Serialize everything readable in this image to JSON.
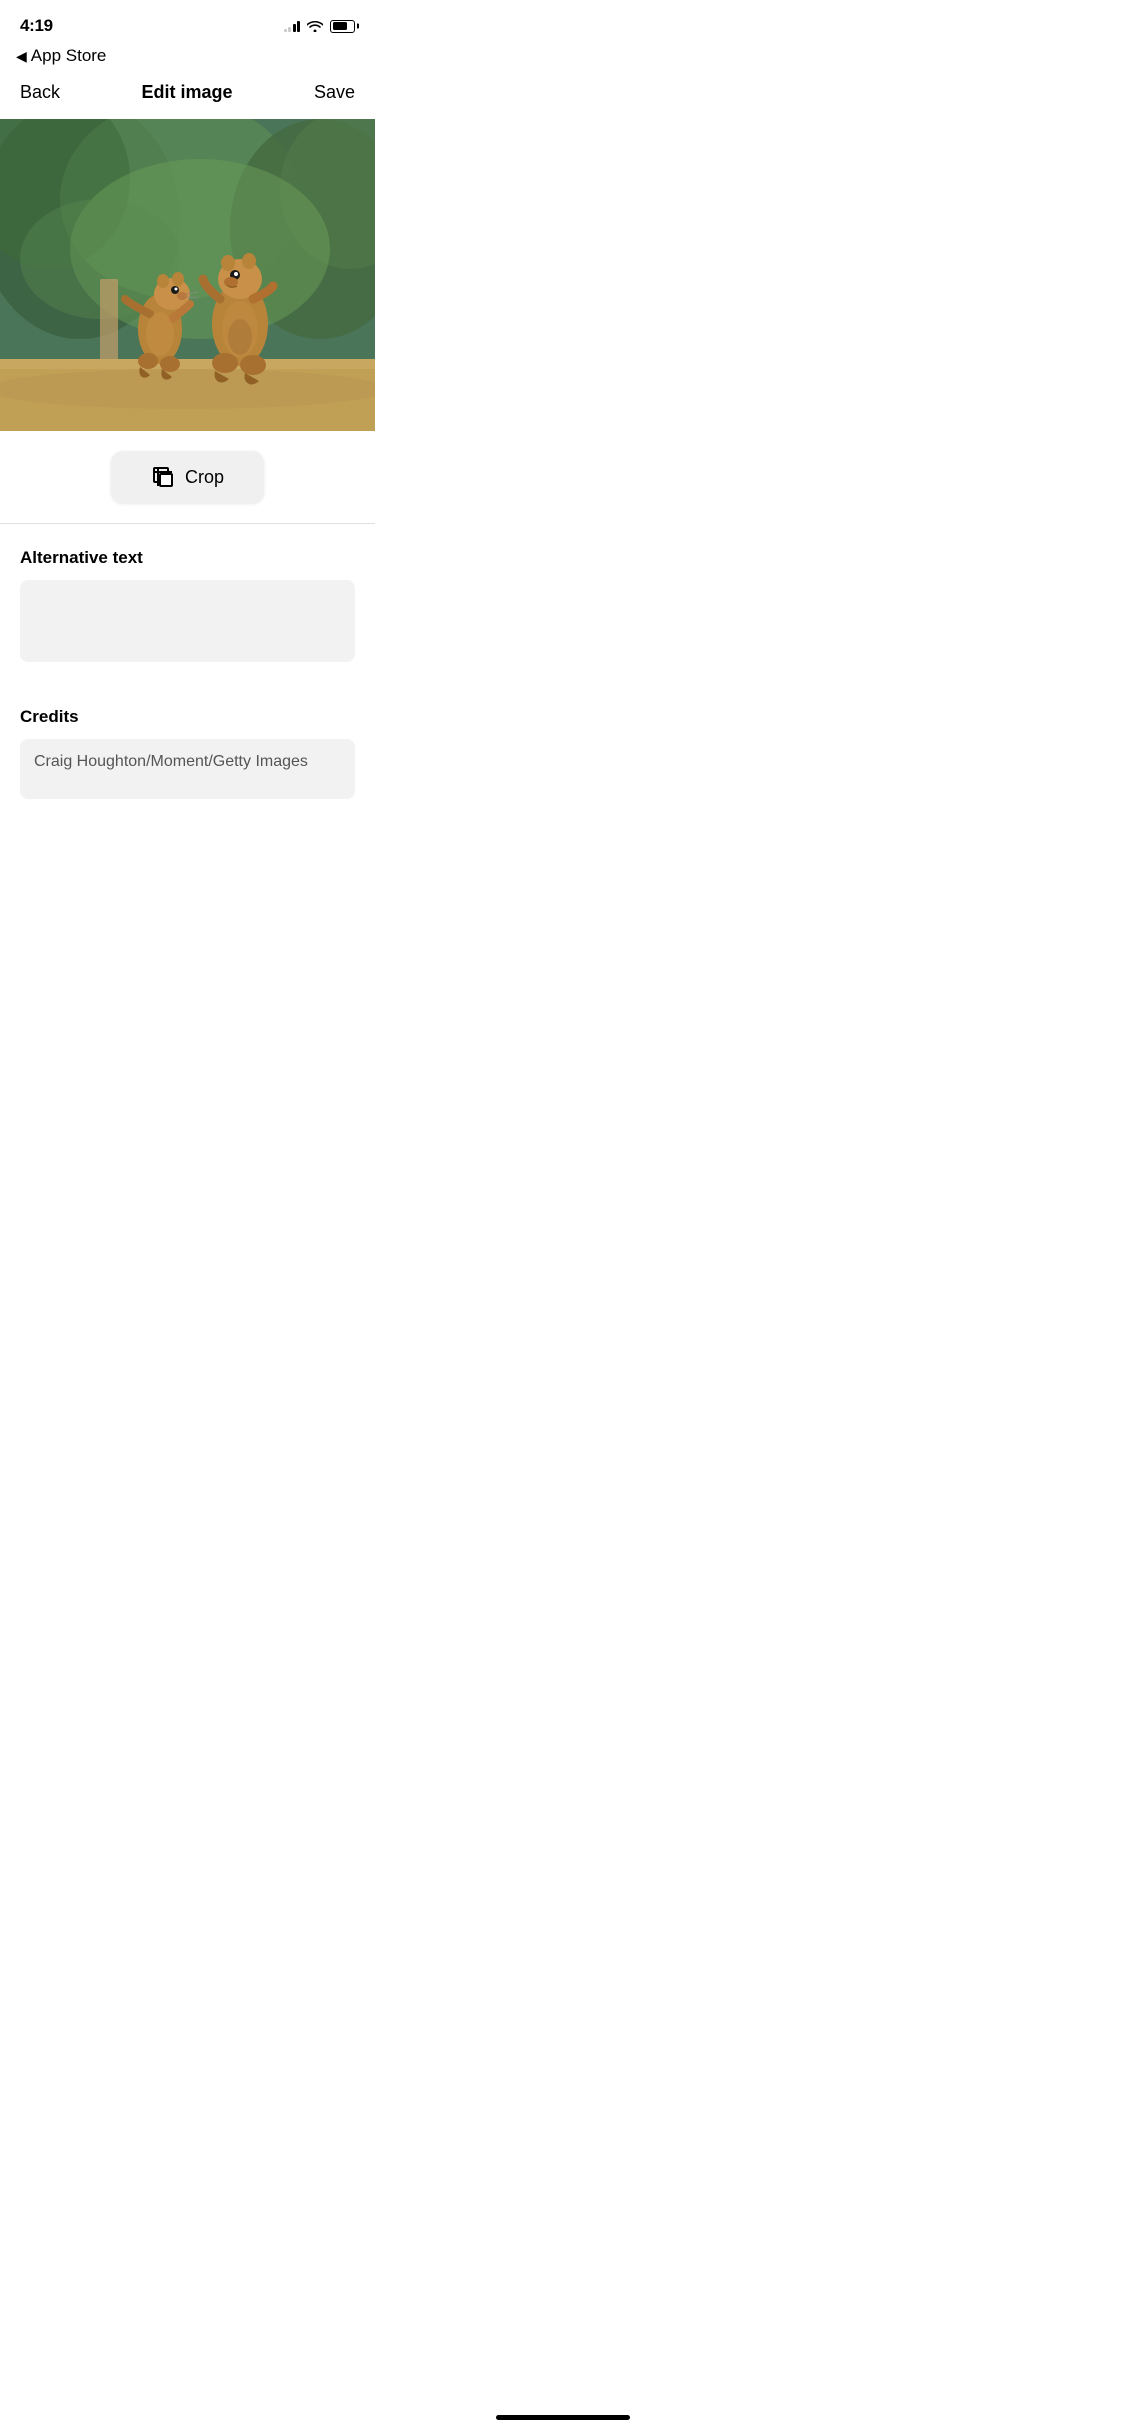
{
  "statusBar": {
    "time": "4:19",
    "batteryLevel": 70
  },
  "appStoreBack": {
    "arrow": "◀",
    "label": "App Store"
  },
  "navBar": {
    "backLabel": "Back",
    "title": "Edit image",
    "saveLabel": "Save"
  },
  "cropButton": {
    "label": "Crop",
    "iconAlt": "crop-icon"
  },
  "altText": {
    "sectionLabel": "Alternative text",
    "placeholder": "",
    "value": ""
  },
  "credits": {
    "sectionLabel": "Credits",
    "value": "Craig Houghton/Moment/Getty Images"
  }
}
